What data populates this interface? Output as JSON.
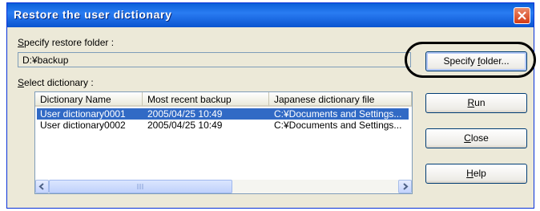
{
  "dialog": {
    "title": "Restore the user dictionary",
    "close_icon": "close-x-icon"
  },
  "restore_folder": {
    "label_pre": "",
    "label_key": "S",
    "label_rest": "pecify restore folder :",
    "label_full": "Specify restore folder :",
    "value": "D:¥backup"
  },
  "dictionary_list": {
    "label_key": "S",
    "label_rest": "elect dictionary :",
    "columns": [
      "Dictionary Name",
      "Most recent backup",
      "Japanese dictionary file"
    ],
    "rows": [
      {
        "name": "User dictionary0001",
        "backup": "2005/04/25 10:49",
        "file": "C:¥Documents and Settings...",
        "selected": true
      },
      {
        "name": "User dictionary0002",
        "backup": "2005/04/25 10:49",
        "file": "C:¥Documents and Settings...",
        "selected": false
      }
    ],
    "scroll_position": 0.0
  },
  "buttons": {
    "specify_folder": {
      "pre": "Specify ",
      "key": "f",
      "post": "older..."
    },
    "run": {
      "pre": "",
      "key": "R",
      "post": "un"
    },
    "close": {
      "pre": "",
      "key": "C",
      "post": "lose"
    },
    "help": {
      "pre": "",
      "key": "H",
      "post": "elp"
    }
  },
  "colors": {
    "titlebar": "#0a5fd8",
    "selection": "#316ac5",
    "dialog_bg": "#ece9d8"
  }
}
